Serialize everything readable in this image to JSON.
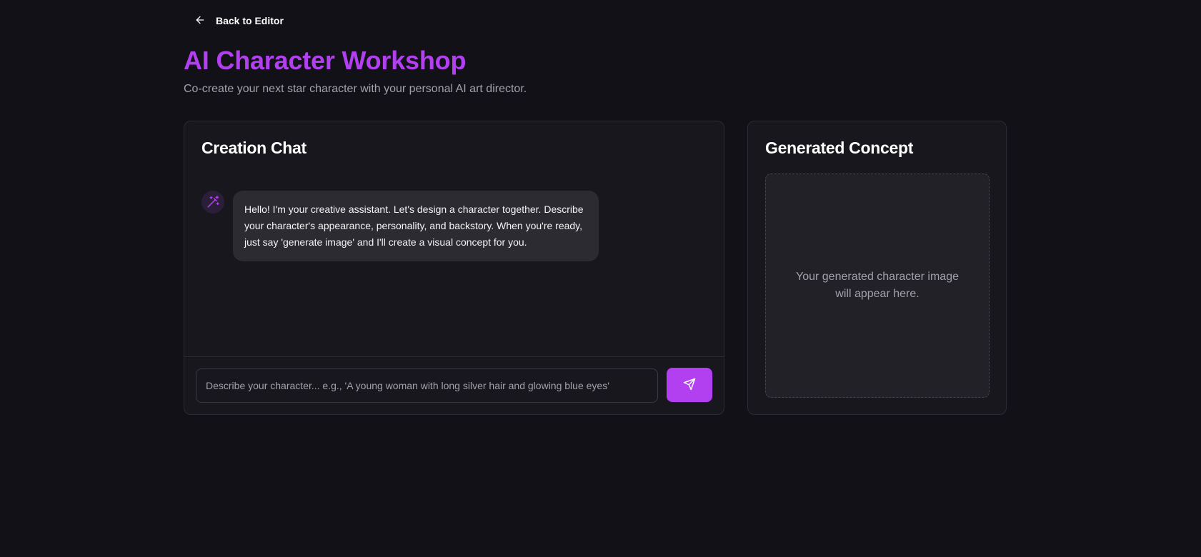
{
  "nav": {
    "back_label": "Back to Editor"
  },
  "header": {
    "title": "AI Character Workshop",
    "subtitle": "Co-create your next star character with your personal AI art director."
  },
  "chat": {
    "title": "Creation Chat",
    "messages": [
      {
        "role": "assistant",
        "text": "Hello! I'm your creative assistant. Let's design a character together. Describe your character's appearance, personality, and backstory. When you're ready, just say 'generate image' and I'll create a visual concept for you."
      }
    ],
    "input": {
      "value": "",
      "placeholder": "Describe your character... e.g., 'A young woman with long silver hair and glowing blue eyes'"
    }
  },
  "concept": {
    "title": "Generated Concept",
    "placeholder_text": "Your generated character image will appear here."
  },
  "icons": {
    "back": "arrow-left-icon",
    "assistant": "magic-wand-icon",
    "send": "send-icon"
  },
  "colors": {
    "background": "#121117",
    "accent": "#b340f0",
    "panel": "#18171d"
  }
}
